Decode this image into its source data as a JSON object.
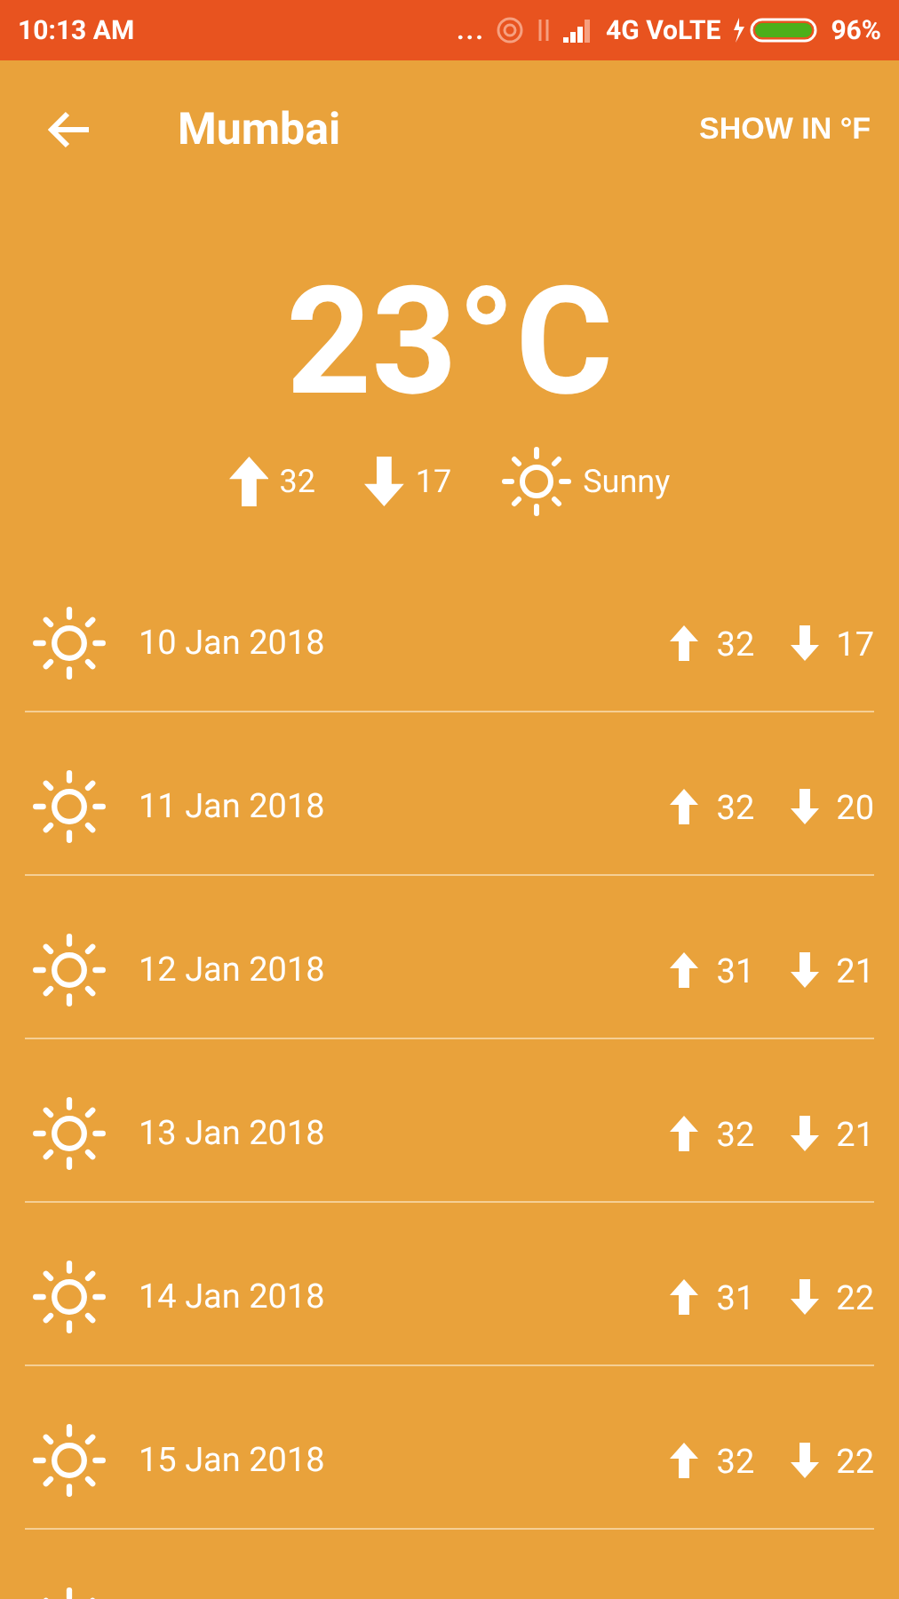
{
  "status_bar": {
    "time": "10:13 AM",
    "more": "...",
    "network": "4G VoLTE",
    "battery": "96%"
  },
  "header": {
    "title": "Mumbai",
    "unit_toggle": "SHOW IN °F"
  },
  "current": {
    "temperature": "23°C",
    "high": "32",
    "low": "17",
    "condition": "Sunny",
    "kind": "sunny"
  },
  "days": [
    {
      "kind": "sunny",
      "date": "10 Jan 2018",
      "high": "32",
      "low": "17"
    },
    {
      "kind": "sunny",
      "date": "11 Jan 2018",
      "high": "32",
      "low": "20"
    },
    {
      "kind": "sunny",
      "date": "12 Jan 2018",
      "high": "31",
      "low": "21"
    },
    {
      "kind": "sunny",
      "date": "13 Jan 2018",
      "high": "32",
      "low": "21"
    },
    {
      "kind": "sunny",
      "date": "14 Jan 2018",
      "high": "31",
      "low": "22"
    },
    {
      "kind": "sunny",
      "date": "15 Jan 2018",
      "high": "32",
      "low": "22"
    },
    {
      "kind": "sunny"
    }
  ]
}
